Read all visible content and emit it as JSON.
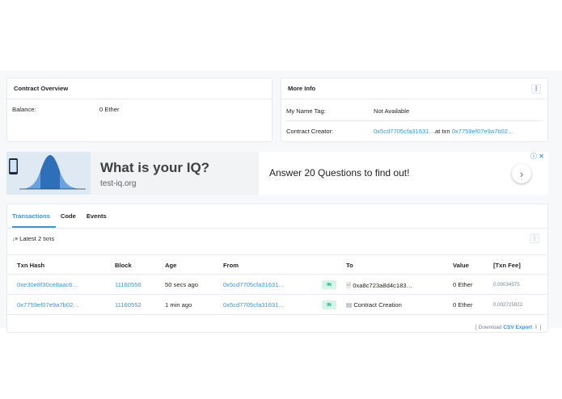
{
  "overview": {
    "title": "Contract Overview",
    "balance_label": "Balance:",
    "balance_value": "0 Ether"
  },
  "more_info": {
    "title": "More Info",
    "menu_icon": "⋮",
    "name_tag_label": "My Name Tag:",
    "name_tag_value": "Not Available",
    "creator_label": "Contract Creator:",
    "creator_address": "0x5cd7705cfa31631…",
    "creator_at": "at txn",
    "creator_txn": "0x7759ef07e9a7b02…"
  },
  "ad": {
    "title": "What is your IQ?",
    "url": "test-iq.org",
    "cta": "Answer 20 Questions to find out!",
    "arrow_icon": "›",
    "ad_choices": "ⓘ ✕"
  },
  "tabs": [
    "Transactions",
    "Code",
    "Events"
  ],
  "txn_summary": {
    "sort_icon": "↓≡",
    "text": "Latest 2 txns",
    "menu_icon": "⋮"
  },
  "table": {
    "headers": {
      "hash": "Txn Hash",
      "block": "Block",
      "age": "Age",
      "from": "From",
      "to": "To",
      "value": "Value",
      "fee": "[Txn Fee]"
    },
    "rows": [
      {
        "hash": "0xe30e8f30ce8aac6…",
        "block": "11160556",
        "age": "50 secs ago",
        "from": "0x5cd7705cfa31631…",
        "direction": "IN",
        "to_icon": "🗎",
        "to": "0xa8c723a8d4c183…",
        "value": "0 Ether",
        "fee": "0.00034575"
      },
      {
        "hash": "0x7759ef07e9a7b02…",
        "block": "11160552",
        "age": "1 min ago",
        "from": "0x5cd7705cfa31631…",
        "direction": "IN",
        "to_icon": "▤",
        "to": "Contract Creation",
        "value": "0 Ether",
        "fee": "0.002725922"
      }
    ]
  },
  "footer": {
    "prefix": "[ Download",
    "csv_label": "CSV Export",
    "suffix": "⇩ ]"
  },
  "colors": {
    "link": "#3498db",
    "in_badge_bg": "#d6f5e6",
    "in_badge_text": "#00a186",
    "page_bg": "#f6f8fa"
  }
}
